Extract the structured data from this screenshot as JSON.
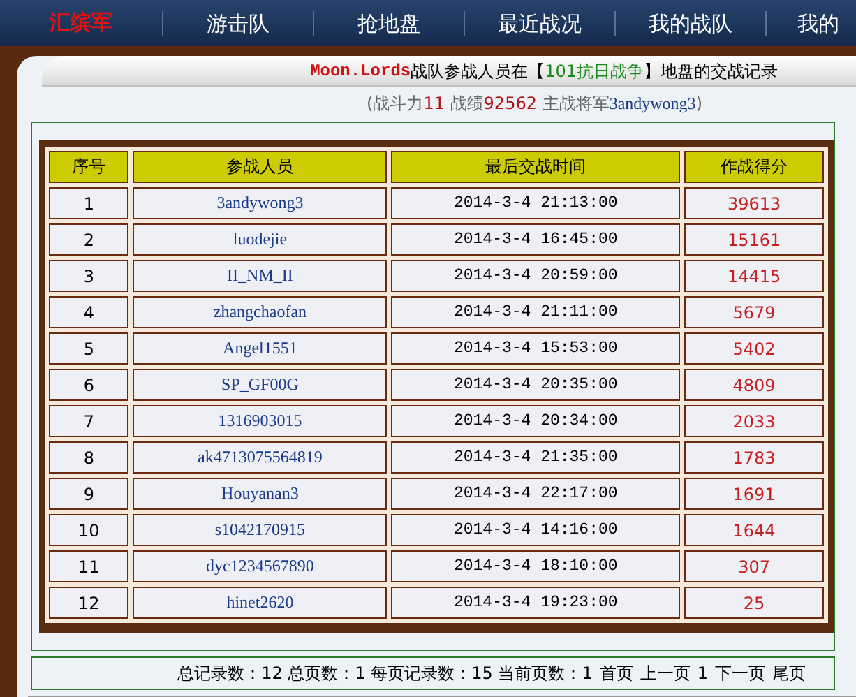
{
  "nav": [
    {
      "label": "汇缤军",
      "selected": true
    },
    {
      "label": "游击队",
      "selected": false
    },
    {
      "label": "抢地盘",
      "selected": false
    },
    {
      "label": "最近战况",
      "selected": false
    },
    {
      "label": "我的战队",
      "selected": false
    },
    {
      "label": "我的",
      "selected": false
    }
  ],
  "title": {
    "team": "Moon.Lords",
    "before": "战队参战人员在【",
    "battlefield": "101抗日战争",
    "after": "】地盘的交战记录"
  },
  "summary": {
    "open": "(",
    "power_label": "战斗力",
    "power": "11",
    "record_label": "战绩",
    "record": "92562",
    "general_label": "主战将军",
    "general": "3andywong3",
    "close": ")"
  },
  "table": {
    "columns": [
      "序号",
      "参战人员",
      "最后交战时间",
      "作战得分"
    ],
    "rows": [
      [
        "1",
        "3andywong3",
        "2014-3-4 21:13:00",
        "39613"
      ],
      [
        "2",
        "luodejie",
        "2014-3-4 16:45:00",
        "15161"
      ],
      [
        "3",
        "II_NM_II",
        "2014-3-4 20:59:00",
        "14415"
      ],
      [
        "4",
        "zhangchaofan",
        "2014-3-4 21:11:00",
        "5679"
      ],
      [
        "5",
        "Angel1551",
        "2014-3-4 15:53:00",
        "5402"
      ],
      [
        "6",
        "SP_GF00G",
        "2014-3-4 20:35:00",
        "4809"
      ],
      [
        "7",
        "1316903015",
        "2014-3-4 20:34:00",
        "2033"
      ],
      [
        "8",
        "ak4713075564819",
        "2014-3-4 21:35:00",
        "1783"
      ],
      [
        "9",
        "Houyanan3",
        "2014-3-4 22:17:00",
        "1691"
      ],
      [
        "10",
        "s1042170915",
        "2014-3-4 14:16:00",
        "1644"
      ],
      [
        "11",
        "dyc1234567890",
        "2014-3-4 18:10:00",
        "307"
      ],
      [
        "12",
        "hinet2620",
        "2014-3-4 19:23:00",
        "25"
      ]
    ]
  },
  "pager": {
    "stats": "总记录数：12 总页数：1 每页记录数：15 当前页数：1",
    "links": [
      "首页",
      "上一页",
      "1",
      "下一页",
      "尾页"
    ]
  }
}
